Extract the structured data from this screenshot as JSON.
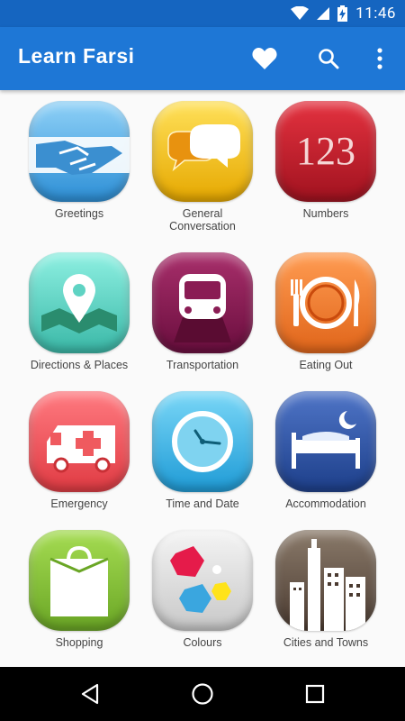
{
  "status_bar": {
    "time": "11:46",
    "icons": [
      "wifi-icon",
      "signal-icon",
      "battery-charging-icon"
    ]
  },
  "app_bar": {
    "title": "Learn Farsi",
    "actions": [
      "heart-icon",
      "search-icon",
      "more-vert-icon"
    ]
  },
  "categories": [
    {
      "label": "Greetings",
      "icon": "handshake-icon",
      "color": "#4aa8e8"
    },
    {
      "label": "General\nConversation",
      "icon": "speech-bubbles-icon",
      "color": "#f2c21b"
    },
    {
      "label": "Numbers",
      "icon": "numbers-123-icon",
      "color": "#c41e3a",
      "text": "123"
    },
    {
      "label": "Directions & Places",
      "icon": "map-pin-icon",
      "color": "#5fd3c3"
    },
    {
      "label": "Transportation",
      "icon": "train-icon",
      "color": "#8a1c54"
    },
    {
      "label": "Eating Out",
      "icon": "plate-cutlery-icon",
      "color": "#f07a2a"
    },
    {
      "label": "Emergency",
      "icon": "ambulance-icon",
      "color": "#ef5a5f"
    },
    {
      "label": "Time and Date",
      "icon": "clock-icon",
      "color": "#38b7e8"
    },
    {
      "label": "Accommodation",
      "icon": "bed-moon-icon",
      "color": "#2f55a5"
    },
    {
      "label": "Shopping",
      "icon": "shopping-bag-icon",
      "color": "#8cc63e"
    },
    {
      "label": "Colours",
      "icon": "color-hexagons-icon",
      "color": "#dcdcdc"
    },
    {
      "label": "Cities and Towns",
      "icon": "city-skyline-icon",
      "color": "#6b5a4e"
    }
  ],
  "nav_bar": {
    "buttons": [
      "back-icon",
      "home-icon",
      "recents-icon"
    ]
  }
}
